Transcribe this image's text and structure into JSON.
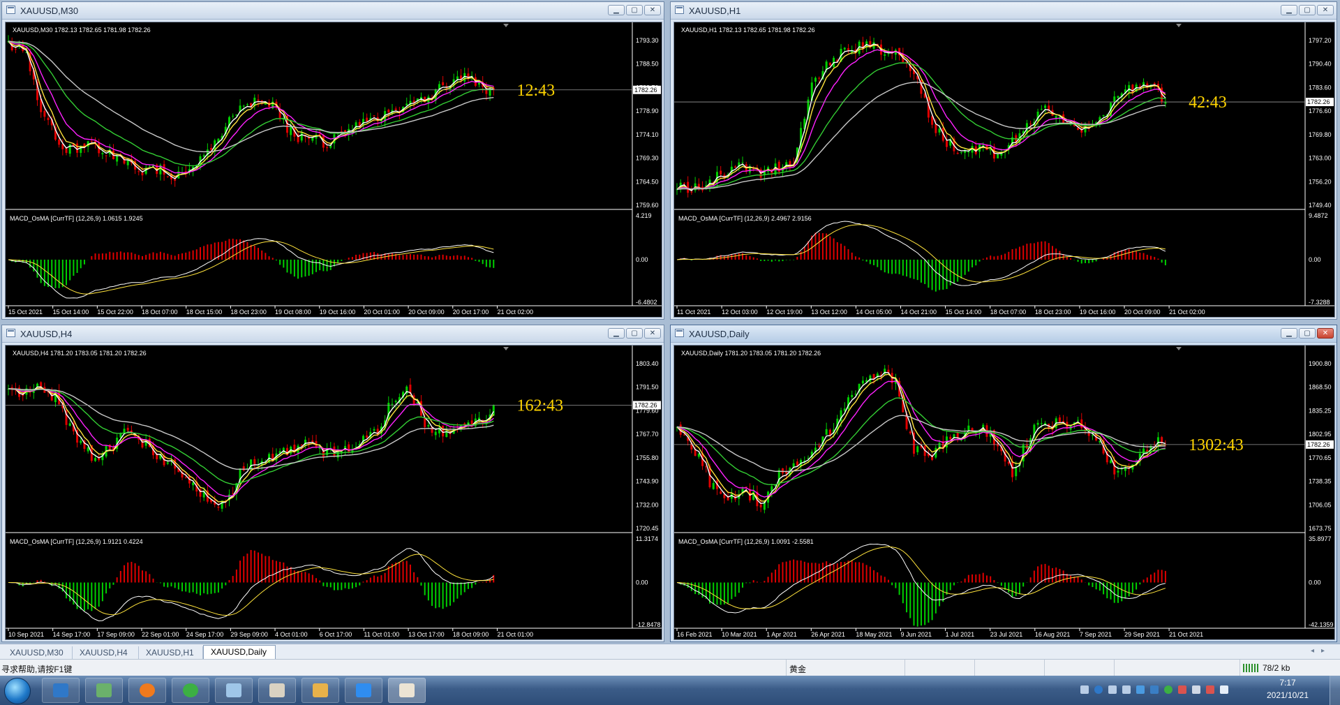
{
  "charts": [
    {
      "id": "m30",
      "window_title": "XAUUSD,M30",
      "info_line": "XAUUSD,M30  1782.13 1782.65 1781.98 1782.26",
      "price_labels": [
        "1793.30",
        "1788.50",
        "1783.70",
        "1778.90",
        "1774.10",
        "1769.30",
        "1764.50",
        "1759.60"
      ],
      "current_price": "1782.26",
      "countdown": "12:43",
      "macd_title": "MACD_OsMA [CurrTF] (12,26,9) 1.0615 1.9245",
      "macd_labels": [
        "4.219",
        "0.00",
        "-6.4802"
      ],
      "time_labels": [
        "15 Oct 2021",
        "15 Oct 14:00",
        "15 Oct 22:00",
        "18 Oct 07:00",
        "18 Oct 15:00",
        "18 Oct 23:00",
        "19 Oct 08:00",
        "19 Oct 16:00",
        "20 Oct 01:00",
        "20 Oct 09:00",
        "20 Oct 17:00",
        "21 Oct 02:00"
      ],
      "seed": 11,
      "trend": [
        0.95,
        0.9,
        0.55,
        0.35,
        0.3,
        0.35,
        0.28,
        0.22,
        0.18,
        0.2,
        0.15,
        0.22,
        0.3,
        0.45,
        0.55,
        0.62,
        0.55,
        0.4,
        0.38,
        0.35,
        0.4,
        0.45,
        0.5,
        0.55,
        0.6,
        0.62,
        0.7,
        0.75,
        0.72,
        0.65
      ]
    },
    {
      "id": "h1",
      "window_title": "XAUUSD,H1",
      "info_line": "XAUUSD,H1  1782.13 1782.65 1781.98 1782.26",
      "price_labels": [
        "1797.20",
        "1790.40",
        "1783.60",
        "1776.60",
        "1769.80",
        "1763.00",
        "1756.20",
        "1749.40"
      ],
      "current_price": "1782.26",
      "countdown": "42:43",
      "macd_title": "MACD_OsMA [CurrTF] (12,26,9) 2.4967 2.9156",
      "macd_labels": [
        "9.4872",
        "0.00",
        "-7.3288"
      ],
      "time_labels": [
        "11 Oct 2021",
        "12 Oct 03:00",
        "12 Oct 19:00",
        "13 Oct 12:00",
        "14 Oct 05:00",
        "14 Oct 21:00",
        "15 Oct 14:00",
        "18 Oct 07:00",
        "18 Oct 23:00",
        "19 Oct 16:00",
        "20 Oct 09:00",
        "21 Oct 02:00"
      ],
      "seed": 23,
      "trend": [
        0.1,
        0.08,
        0.12,
        0.18,
        0.2,
        0.15,
        0.2,
        0.25,
        0.7,
        0.85,
        0.9,
        0.95,
        0.92,
        0.88,
        0.8,
        0.5,
        0.35,
        0.3,
        0.32,
        0.28,
        0.35,
        0.5,
        0.55,
        0.48,
        0.42,
        0.5,
        0.6,
        0.68,
        0.72,
        0.6
      ]
    },
    {
      "id": "h4",
      "window_title": "XAUUSD,H4",
      "info_line": "XAUUSD,H4  1781.20 1783.05 1781.20 1782.26",
      "price_labels": [
        "1803.40",
        "1791.50",
        "1779.60",
        "1767.70",
        "1755.80",
        "1743.90",
        "1732.00",
        "1720.45"
      ],
      "current_price": "1782.26",
      "countdown": "162:43",
      "macd_title": "MACD_OsMA [CurrTF] (12,26,9) 1.9121 0.4224",
      "macd_labels": [
        "11.3174",
        "0.00",
        "-12.8478"
      ],
      "time_labels": [
        "10 Sep 2021",
        "14 Sep 17:00",
        "17 Sep 09:00",
        "22 Sep 01:00",
        "24 Sep 17:00",
        "29 Sep 09:00",
        "4 Oct 01:00",
        "6 Oct 17:00",
        "11 Oct 01:00",
        "13 Oct 17:00",
        "18 Oct 09:00",
        "21 Oct 01:00"
      ],
      "seed": 37,
      "trend": [
        0.8,
        0.78,
        0.82,
        0.75,
        0.5,
        0.4,
        0.45,
        0.55,
        0.5,
        0.4,
        0.35,
        0.25,
        0.15,
        0.1,
        0.35,
        0.4,
        0.42,
        0.45,
        0.48,
        0.42,
        0.45,
        0.5,
        0.55,
        0.75,
        0.8,
        0.6,
        0.55,
        0.6,
        0.62,
        0.68
      ]
    },
    {
      "id": "d1",
      "window_title": "XAUUSD,Daily",
      "info_line": "XAUUSD,Daily  1781.20 1783.05 1781.20 1782.26",
      "price_labels": [
        "1900.80",
        "1868.50",
        "1835.25",
        "1802.95",
        "1770.65",
        "1738.35",
        "1706.05",
        "1673.75"
      ],
      "current_price": "1782.26",
      "countdown": "1302:43",
      "macd_title": "MACD_OsMA [CurrTF] (12,26,9) 1.0091 -2.5581",
      "macd_labels": [
        "35.8977",
        "0.00",
        "-42.1359"
      ],
      "time_labels": [
        "16 Feb 2021",
        "10 Mar 2021",
        "1 Apr 2021",
        "26 Apr 2021",
        "18 May 2021",
        "9 Jun 2021",
        "1 Jul 2021",
        "23 Jul 2021",
        "16 Aug 2021",
        "7 Sep 2021",
        "29 Sep 2021",
        "21 Oct 2021"
      ],
      "seed": 53,
      "trend": [
        0.6,
        0.45,
        0.25,
        0.15,
        0.2,
        0.12,
        0.3,
        0.35,
        0.45,
        0.55,
        0.7,
        0.85,
        0.92,
        0.85,
        0.45,
        0.4,
        0.5,
        0.55,
        0.6,
        0.48,
        0.3,
        0.55,
        0.6,
        0.62,
        0.58,
        0.5,
        0.3,
        0.38,
        0.48,
        0.5
      ]
    }
  ],
  "tabs": [
    "XAUUSD,M30",
    "XAUUSD,H4",
    "XAUUSD,H1",
    "XAUUSD,Daily"
  ],
  "active_tab": "XAUUSD,Daily",
  "status": {
    "help": "寻求帮助,请按F1键",
    "profile": "黄金",
    "traffic": "78/2 kb"
  },
  "clock": {
    "time": "7:17",
    "date": "2021/10/21"
  },
  "colors": {
    "bull": "#00d000",
    "bear": "#e00000",
    "ma_fast": "#ffffff",
    "ma_yellow": "#ffe33c",
    "ma_magenta": "#ff22ff",
    "ma_green": "#33cc33",
    "ma_gray": "#c8c8c8",
    "countdown": "#ffd400"
  }
}
